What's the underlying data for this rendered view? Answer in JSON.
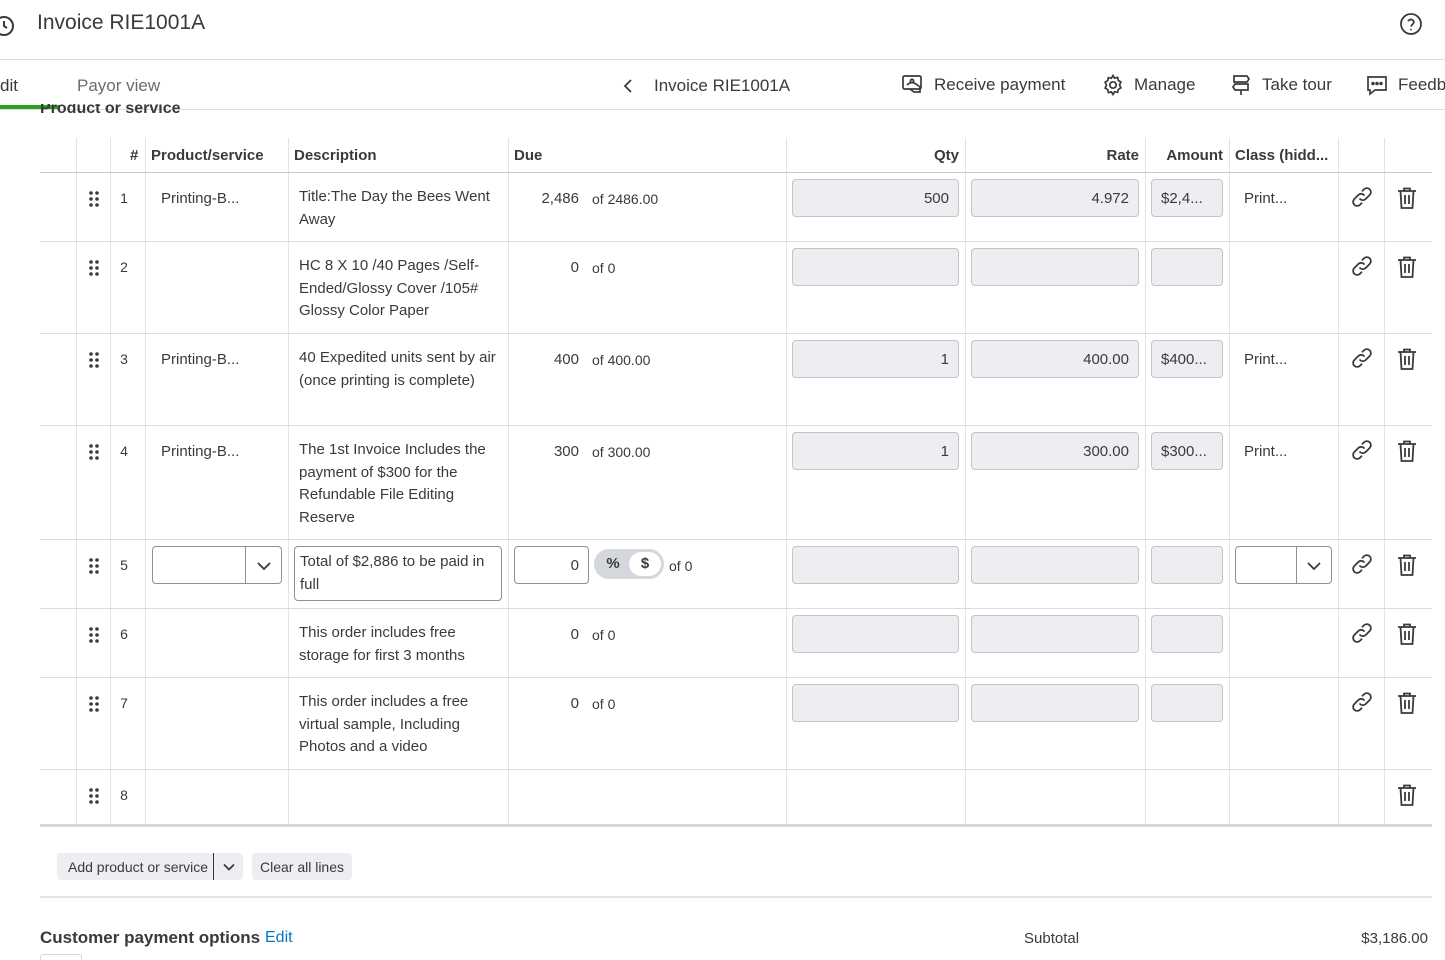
{
  "header": {
    "title": "Invoice RIE1001A"
  },
  "nav": {
    "tab_edit": "dit",
    "tab_payor": "Payor view",
    "invoice_label": "Invoice RIE1001A",
    "receive_payment": "Receive payment",
    "manage": "Manage",
    "take_tour": "Take tour",
    "feedback": "Feedb"
  },
  "section": {
    "title": "Product or service"
  },
  "table": {
    "columns": {
      "num": "#",
      "product": "Product/service",
      "description": "Description",
      "due": "Due",
      "qty": "Qty",
      "rate": "Rate",
      "amount": "Amount",
      "class": "Class (hidd..."
    },
    "rows": [
      {
        "num": "1",
        "product": "Printing-B...",
        "description": "Title:The Day the Bees Went Away",
        "due": "2,486",
        "due_of": "of 2486.00",
        "qty": "500",
        "rate": "4.972",
        "amount": "$2,4...",
        "class": "Print..."
      },
      {
        "num": "2",
        "product": "",
        "description": "HC 8  X 10 /40 Pages /Self-Ended/Glossy Cover /105# Glossy Color Paper",
        "due": "0",
        "due_of": "of 0",
        "qty": "",
        "rate": "",
        "amount": "",
        "class": ""
      },
      {
        "num": "3",
        "product": "Printing-B...",
        "description": "40 Expedited units sent by air (once printing is complete)",
        "due": "400",
        "due_of": "of 400.00",
        "qty": "1",
        "rate": "400.00",
        "amount": "$400...",
        "class": "Print..."
      },
      {
        "num": "4",
        "product": "Printing-B...",
        "description": "The 1st Invoice Includes the payment of $300 for the Refundable File Editing Reserve",
        "due": "300",
        "due_of": "of 300.00",
        "qty": "1",
        "rate": "300.00",
        "amount": "$300...",
        "class": "Print..."
      },
      {
        "num": "5",
        "product": "",
        "description": "Total of $2,886 to be paid in full",
        "due": "0",
        "due_of": "of 0",
        "toggle_pct": "%",
        "toggle_dollar": "$",
        "qty": "",
        "rate": "",
        "amount": "",
        "class": ""
      },
      {
        "num": "6",
        "product": "",
        "description": "This order includes free storage for first 3 months",
        "due": "0",
        "due_of": "of 0",
        "qty": "",
        "rate": "",
        "amount": "",
        "class": ""
      },
      {
        "num": "7",
        "product": "",
        "description": "This order includes a  free virtual sample, Including Photos and a video",
        "due": "0",
        "due_of": "of 0",
        "qty": "",
        "rate": "",
        "amount": "",
        "class": ""
      },
      {
        "num": "8"
      }
    ]
  },
  "actions": {
    "add_product": "Add product or service",
    "clear_lines": "Clear all lines"
  },
  "footer": {
    "payment_options": "Customer payment options",
    "edit": "Edit",
    "subtotal_label": "Subtotal",
    "subtotal_value": "$3,186.00"
  }
}
